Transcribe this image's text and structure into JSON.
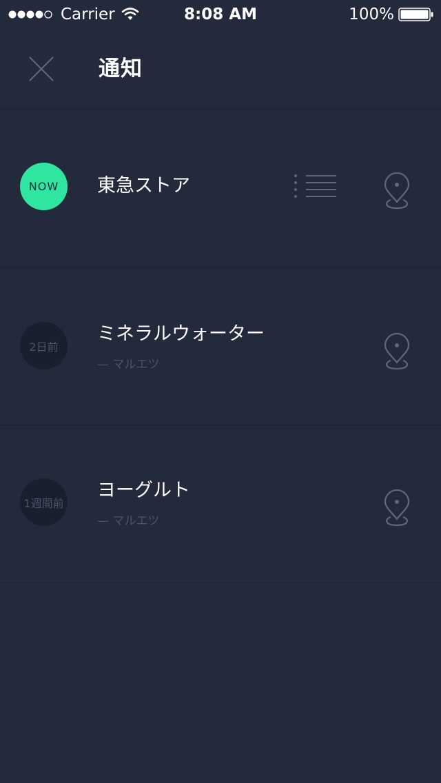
{
  "status_bar": {
    "carrier": "Carrier",
    "time": "8:08 AM",
    "battery": "100%"
  },
  "header": {
    "title": "通知"
  },
  "notifications": [
    {
      "badge": "NOW",
      "title": "東急ストア",
      "subtitle": ""
    },
    {
      "badge": "2日前",
      "title": "ミネラルウォーター",
      "subtitle": "— マルエツ"
    },
    {
      "badge": "1週間前",
      "title": "ヨーグルト",
      "subtitle": "— マルエツ"
    }
  ],
  "colors": {
    "background": "#222a3c",
    "accent": "#2ee6a0",
    "divider": "#1b2232",
    "icon": "#5f6778"
  },
  "icons": {
    "close": "close-icon",
    "list": "list-icon",
    "location": "location-pin-icon"
  }
}
